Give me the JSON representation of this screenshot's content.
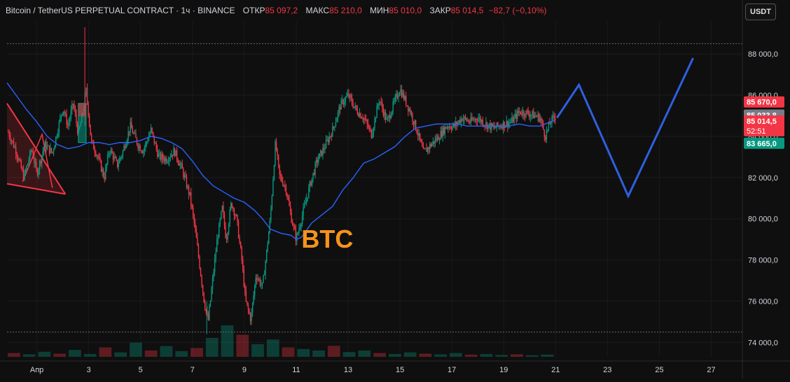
{
  "header": {
    "symbol": "Bitcoin / TetherUS PERPETUAL CONTRACT · 1ч · BINANCE",
    "open_label": "ОТКР",
    "open_value": "85 097,2",
    "high_label": "МАКС",
    "high_value": "85 210,0",
    "low_label": "МИН",
    "low_value": "85 010,0",
    "close_label": "ЗАКР",
    "close_value": "85 014,5",
    "change": "−82,7 (−0,10%)"
  },
  "currency_button": "USDT",
  "colors": {
    "background": "#0f0f0f",
    "up_candle": "#089981",
    "down_candle": "#f23645",
    "moving_average": "#2962ff",
    "projection": "#2f5fe0",
    "annotation": "#f7931a",
    "triangle": "#f23645"
  },
  "chart_data": {
    "type": "candlestick",
    "title": "Bitcoin / TetherUS PERPETUAL CONTRACT · 1ч · BINANCE",
    "xlabel": "",
    "ylabel": "",
    "x_ticks": [
      {
        "day": 1,
        "label": "Апр"
      },
      {
        "day": 3,
        "label": "3"
      },
      {
        "day": 5,
        "label": "5"
      },
      {
        "day": 7,
        "label": "7"
      },
      {
        "day": 9,
        "label": "9"
      },
      {
        "day": 11,
        "label": "11"
      },
      {
        "day": 13,
        "label": "13"
      },
      {
        "day": 15,
        "label": "15"
      },
      {
        "day": 17,
        "label": "17"
      },
      {
        "day": 19,
        "label": "19"
      },
      {
        "day": 21,
        "label": "21"
      },
      {
        "day": 23,
        "label": "23"
      },
      {
        "day": 25,
        "label": "25"
      },
      {
        "day": 27,
        "label": "27"
      }
    ],
    "y_ticks": [
      {
        "value": 88000,
        "label": "88 000,0"
      },
      {
        "value": 86000,
        "label": "86 000,0"
      },
      {
        "value": 84000,
        "label": "84 000,0"
      },
      {
        "value": 82000,
        "label": "82 000,0"
      },
      {
        "value": 80000,
        "label": "80 000,0"
      },
      {
        "value": 78000,
        "label": "78 000,0"
      },
      {
        "value": 76000,
        "label": "76 000,0"
      },
      {
        "value": 74000,
        "label": "74 000,0"
      }
    ],
    "x_range_days": [
      -0.15,
      28.2
    ],
    "y_range": [
      73300,
      89600
    ],
    "price_path": [
      [
        -0.1,
        84200
      ],
      [
        0.2,
        83300
      ],
      [
        0.5,
        82000
      ],
      [
        0.8,
        83400
      ],
      [
        1.0,
        82200
      ],
      [
        1.3,
        83600
      ],
      [
        1.6,
        83200
      ],
      [
        1.8,
        84300
      ],
      [
        2.0,
        85400
      ],
      [
        2.2,
        84500
      ],
      [
        2.4,
        85600
      ],
      [
        2.6,
        84100
      ],
      [
        2.8,
        85300
      ],
      [
        2.9,
        86200
      ],
      [
        3.0,
        85000
      ],
      [
        3.1,
        83700
      ],
      [
        3.3,
        83200
      ],
      [
        3.6,
        82000
      ],
      [
        3.8,
        83400
      ],
      [
        4.1,
        82600
      ],
      [
        4.3,
        83200
      ],
      [
        4.6,
        84500
      ],
      [
        4.9,
        83600
      ],
      [
        5.1,
        83300
      ],
      [
        5.4,
        84300
      ],
      [
        5.7,
        83000
      ],
      [
        6.0,
        82900
      ],
      [
        6.3,
        83300
      ],
      [
        6.6,
        82400
      ],
      [
        6.9,
        81100
      ],
      [
        7.1,
        79500
      ],
      [
        7.3,
        77500
      ],
      [
        7.45,
        76000
      ],
      [
        7.6,
        75000
      ],
      [
        7.75,
        76700
      ],
      [
        7.95,
        79000
      ],
      [
        8.15,
        80500
      ],
      [
        8.3,
        79000
      ],
      [
        8.5,
        80800
      ],
      [
        8.7,
        80000
      ],
      [
        8.9,
        78000
      ],
      [
        9.05,
        76000
      ],
      [
        9.25,
        75100
      ],
      [
        9.45,
        77300
      ],
      [
        9.7,
        76700
      ],
      [
        9.85,
        78300
      ],
      [
        10.0,
        80000
      ],
      [
        10.2,
        83700
      ],
      [
        10.35,
        82100
      ],
      [
        10.6,
        81500
      ],
      [
        10.8,
        80100
      ],
      [
        11.0,
        79000
      ],
      [
        11.2,
        80000
      ],
      [
        11.5,
        81500
      ],
      [
        11.8,
        82800
      ],
      [
        12.1,
        83500
      ],
      [
        12.4,
        84300
      ],
      [
        12.7,
        85500
      ],
      [
        13.0,
        86000
      ],
      [
        13.3,
        85300
      ],
      [
        13.6,
        84900
      ],
      [
        13.9,
        84100
      ],
      [
        14.2,
        85800
      ],
      [
        14.5,
        84700
      ],
      [
        14.8,
        85700
      ],
      [
        15.0,
        86300
      ],
      [
        15.4,
        85200
      ],
      [
        15.7,
        84100
      ],
      [
        15.9,
        83200
      ],
      [
        16.2,
        83600
      ],
      [
        16.5,
        84000
      ],
      [
        16.8,
        84500
      ],
      [
        17.1,
        84500
      ],
      [
        17.4,
        84900
      ],
      [
        17.7,
        84700
      ],
      [
        18.0,
        84900
      ],
      [
        18.3,
        84600
      ],
      [
        18.6,
        84400
      ],
      [
        19.0,
        84600
      ],
      [
        19.3,
        84700
      ],
      [
        19.6,
        85200
      ],
      [
        20.0,
        85100
      ],
      [
        20.4,
        84900
      ],
      [
        20.6,
        84000
      ],
      [
        20.8,
        84700
      ],
      [
        21.0,
        85000
      ]
    ],
    "moving_average": [
      [
        -0.15,
        86600
      ],
      [
        0.2,
        86000
      ],
      [
        0.6,
        85300
      ],
      [
        1.0,
        84700
      ],
      [
        1.4,
        84000
      ],
      [
        1.8,
        83600
      ],
      [
        2.2,
        83400
      ],
      [
        2.6,
        83500
      ],
      [
        3.0,
        83700
      ],
      [
        3.4,
        83700
      ],
      [
        3.8,
        83600
      ],
      [
        4.2,
        83700
      ],
      [
        4.6,
        83700
      ],
      [
        5.0,
        83800
      ],
      [
        5.4,
        84000
      ],
      [
        5.8,
        83900
      ],
      [
        6.2,
        83700
      ],
      [
        6.6,
        83400
      ],
      [
        7.0,
        82800
      ],
      [
        7.4,
        82100
      ],
      [
        7.8,
        81600
      ],
      [
        8.2,
        81300
      ],
      [
        8.6,
        81000
      ],
      [
        9.0,
        80800
      ],
      [
        9.4,
        80400
      ],
      [
        9.7,
        80000
      ],
      [
        10.0,
        79500
      ],
      [
        10.4,
        79300
      ],
      [
        10.8,
        79200
      ],
      [
        11.0,
        79000
      ],
      [
        11.2,
        79100
      ],
      [
        11.6,
        79800
      ],
      [
        12.0,
        80200
      ],
      [
        12.4,
        80600
      ],
      [
        12.8,
        81400
      ],
      [
        13.2,
        82000
      ],
      [
        13.6,
        82700
      ],
      [
        14.0,
        82900
      ],
      [
        14.4,
        83200
      ],
      [
        14.8,
        83500
      ],
      [
        15.2,
        84000
      ],
      [
        15.6,
        84400
      ],
      [
        16.0,
        84500
      ],
      [
        16.4,
        84600
      ],
      [
        16.8,
        84600
      ],
      [
        17.2,
        84600
      ],
      [
        17.6,
        84500
      ],
      [
        18.0,
        84500
      ],
      [
        18.4,
        84500
      ],
      [
        18.8,
        84500
      ],
      [
        19.2,
        84500
      ],
      [
        19.6,
        84600
      ],
      [
        20.0,
        84500
      ],
      [
        20.4,
        84500
      ],
      [
        20.8,
        84700
      ],
      [
        21.0,
        84800
      ]
    ],
    "projection_path": [
      [
        21.05,
        84900
      ],
      [
        21.9,
        86500
      ],
      [
        23.8,
        81100
      ],
      [
        26.3,
        87800
      ]
    ],
    "triangle": {
      "upper": [
        [
          -0.15,
          85600
        ],
        [
          2.1,
          81200
        ]
      ],
      "lower": [
        [
          -0.15,
          81700
        ],
        [
          2.1,
          81200
        ]
      ],
      "extra": [
        [
          0.45,
          81800
        ],
        [
          1.2,
          84100
        ],
        [
          1.6,
          81500
        ]
      ]
    },
    "highlight_box": {
      "day_start": 2.6,
      "day_end": 2.9,
      "price_low": 83700,
      "price_high": 85600
    },
    "annotation": {
      "text": "BTC",
      "day": 11.2,
      "price": 78600
    },
    "horizontal_lines": [
      88500,
      74500
    ],
    "price_labels": [
      {
        "value": 85670,
        "text": "85 670,0",
        "color": "#f23645",
        "text_color": "#ffffff"
      },
      {
        "value": 85033.8,
        "text": "85 033,8",
        "color": "#787b86",
        "text_color": "#ffffff"
      },
      {
        "value": 84750,
        "text": "85 014,5",
        "sub": "52:51",
        "color": "#f23645",
        "text_color": "#ffffff"
      },
      {
        "value": 83665,
        "text": "83 665,0",
        "color": "#089981",
        "text_color": "#ffffff"
      }
    ],
    "volume_levels": [
      0.12,
      0.08,
      0.16,
      0.1,
      0.22,
      0.09,
      0.3,
      0.14,
      0.45,
      0.2,
      0.34,
      0.18,
      0.28,
      0.6,
      1.0,
      0.7,
      0.4,
      0.55,
      0.3,
      0.25,
      0.2,
      0.35,
      0.15,
      0.2,
      0.12,
      0.09,
      0.14,
      0.1,
      0.08,
      0.12,
      0.07,
      0.09,
      0.06,
      0.08,
      0.05,
      0.07
    ]
  }
}
